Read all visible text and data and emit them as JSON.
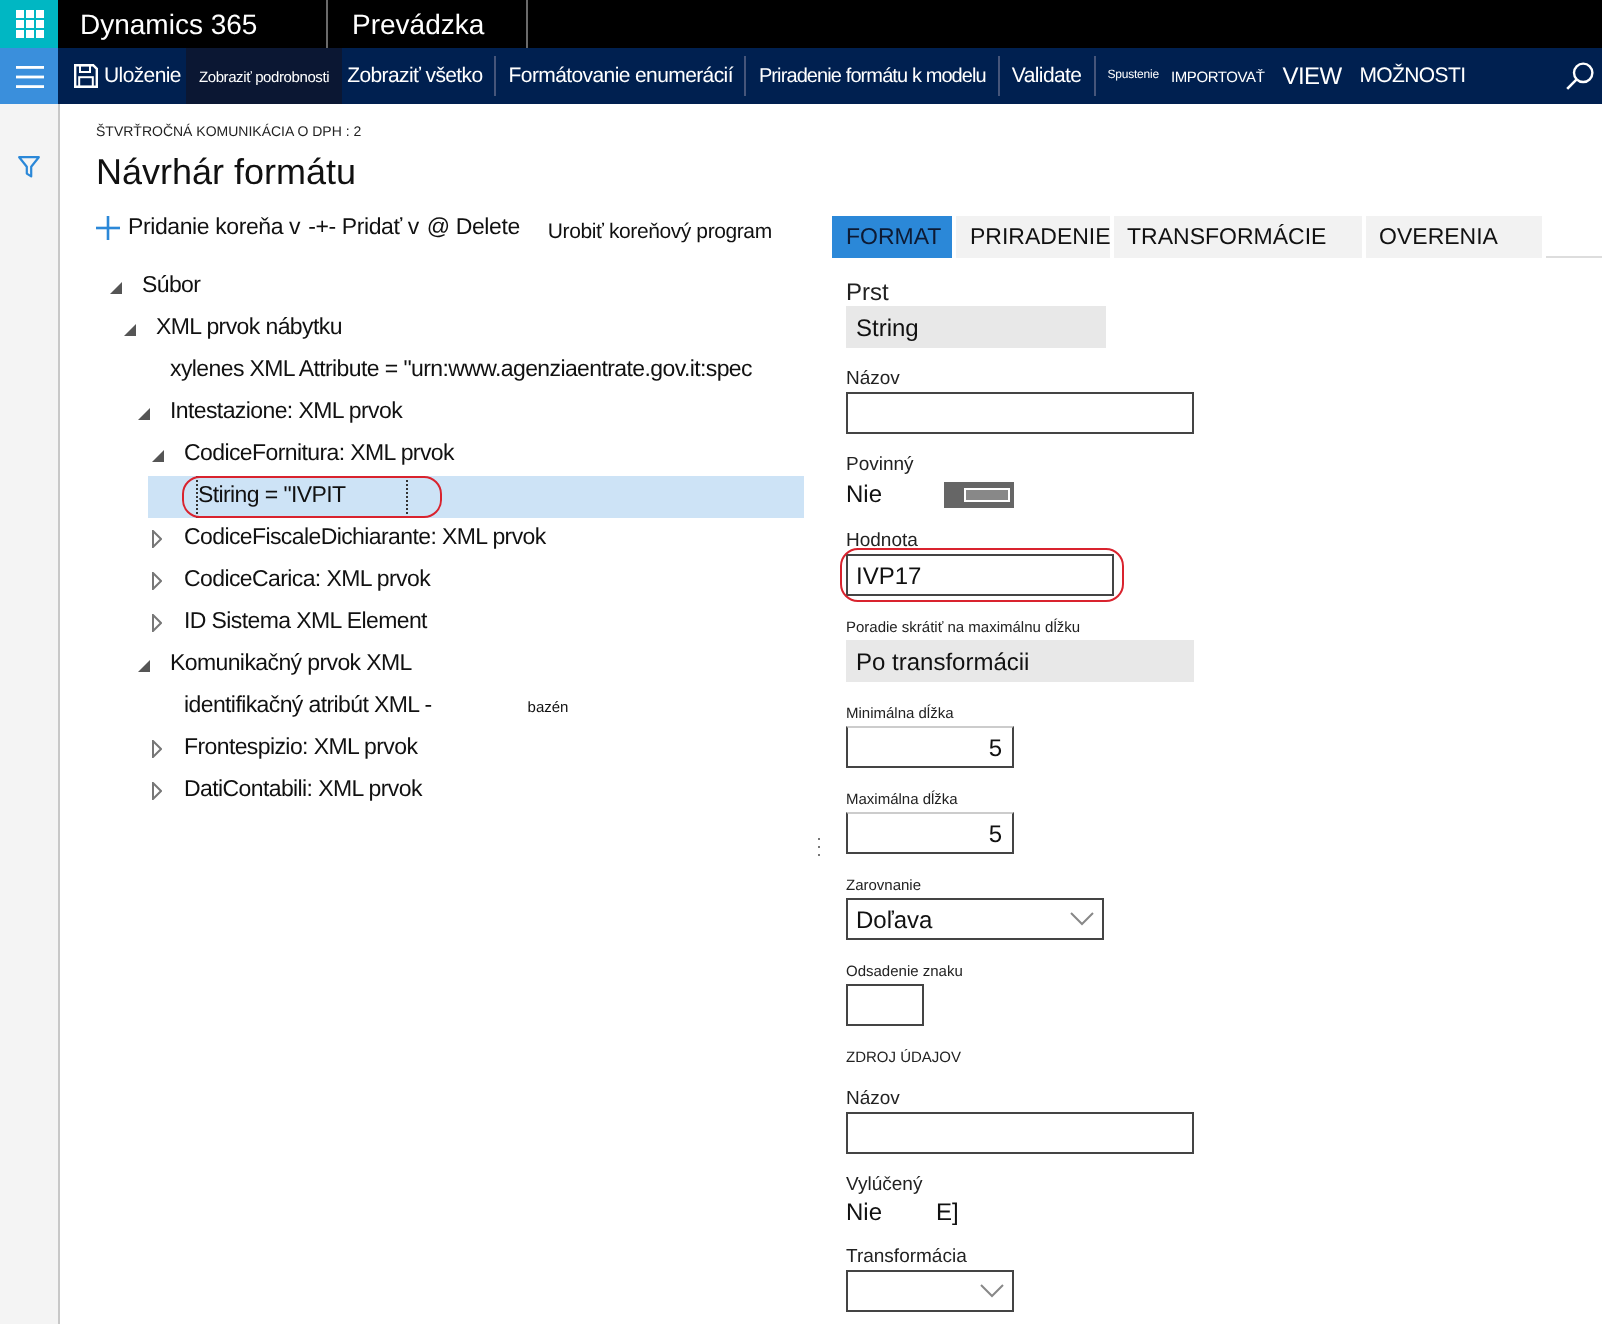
{
  "top_bar": {
    "app_name": "Dynamics 365",
    "module": "Prevádzka"
  },
  "action_bar": {
    "groups": [
      [
        {
          "label": "Uloženie",
          "kind": "save",
          "active": false
        },
        {
          "label": "Zobraziť podrobnosti",
          "kind": "compact",
          "active": true
        },
        {
          "label": "Zobraziť všetko",
          "kind": "normal",
          "active": false
        }
      ],
      [
        {
          "label": "Formátovanie enumerácií",
          "kind": "normal",
          "active": false
        }
      ],
      [
        {
          "label": "Priradenie formátu k modelu",
          "kind": "narrow",
          "active": false
        }
      ],
      [
        {
          "label": "Validate",
          "kind": "normal",
          "active": false
        }
      ],
      [
        {
          "label": "Spustenie",
          "kind": "tiny",
          "active": false
        },
        {
          "label": "IMPORTOVAŤ",
          "kind": "compact",
          "active": false
        },
        {
          "label": "VIEW",
          "kind": "large",
          "active": false
        },
        {
          "label": "MOŽNOSTI",
          "kind": "normal",
          "active": false
        }
      ]
    ]
  },
  "breadcrumb": "ŠTVRŤROČNÁ KOMUNIKÁCIA O DPH : 2",
  "title": "Návrhár formátu",
  "tree_toolbar": [
    {
      "label": "Pridanie koreňa v",
      "kind": "add"
    },
    {
      "label": "-+- Pridať v",
      "kind": "text"
    },
    {
      "label": "@ Delete",
      "kind": "text"
    },
    {
      "label": "Urobiť koreňový program",
      "kind": "small"
    }
  ],
  "tree": [
    {
      "label": "Súbor",
      "kind": "branch",
      "expanded": true,
      "selected": false,
      "children": [
        {
          "label": "XML prvok nábytku",
          "kind": "branch",
          "expanded": true,
          "selected": false,
          "children": [
            {
              "label": "xylenes XML Attribute = \"urn:www.agenziaentrate.gov.it:spec",
              "kind": "leaf",
              "selected": false
            },
            {
              "label": "Intestazione: XML prvok",
              "kind": "branch",
              "expanded": true,
              "selected": false,
              "children": [
                {
                  "label": "CodiceFornitura: XML prvok",
                  "kind": "branch",
                  "expanded": true,
                  "selected": false,
                  "children": [
                    {
                      "label": "Stiring = \"IVPIT",
                      "kind": "leaf",
                      "selected": true,
                      "circled": true
                    }
                  ]
                },
                {
                  "label": "CodiceFiscaleDichiarante: XML prvok",
                  "kind": "branch",
                  "expanded": false,
                  "selected": false
                },
                {
                  "label": "CodiceCarica: XML prvok",
                  "kind": "branch",
                  "expanded": false,
                  "selected": false
                },
                {
                  "label": "ID Sistema XML Element",
                  "kind": "branch",
                  "expanded": false,
                  "selected": false
                }
              ]
            },
            {
              "label": "Komunikačný prvok XML",
              "kind": "branch",
              "expanded": true,
              "selected": false,
              "children": [
                {
                  "label": "identifikačný atribút XML -",
                  "note": "bazén",
                  "kind": "leaf",
                  "selected": false
                },
                {
                  "label": "Frontespizio: XML prvok",
                  "kind": "branch",
                  "expanded": false,
                  "selected": false
                },
                {
                  "label": "DatiContabili: XML prvok",
                  "kind": "branch",
                  "expanded": false,
                  "selected": false
                }
              ]
            }
          ]
        }
      ]
    }
  ],
  "tabs": [
    {
      "label": "FORMAT",
      "selected": true
    },
    {
      "label": "PRIRADENIE",
      "selected": false
    },
    {
      "label": "TRANSFORMÁCIE",
      "selected": false
    },
    {
      "label": "OVERENIA",
      "selected": false
    }
  ],
  "fields": [
    {
      "kind": "readonly",
      "label": "Prst",
      "value": "String"
    },
    {
      "kind": "text",
      "label": "Názov"
    },
    {
      "kind": "toggle",
      "label": "Povinný",
      "value": "Nie",
      "on": false
    },
    {
      "kind": "text",
      "label": "Hodnota",
      "value": "IVP17",
      "circled": true
    },
    {
      "kind": "readonly",
      "label": "Poradie skrátiť na maximálnu dĺžku",
      "value": "Po transformácii"
    },
    {
      "kind": "number",
      "label": "Minimálna dĺžka",
      "value": "5"
    },
    {
      "kind": "number",
      "label": "Maximálna dĺžka",
      "value": "5"
    },
    {
      "kind": "select",
      "label": "Zarovnanie",
      "value": "Doľava"
    },
    {
      "kind": "text",
      "label": "Odsadenie znaku"
    },
    {
      "kind": "section",
      "label": "ZDROJ ÚDAJOV"
    },
    {
      "kind": "text",
      "label": "Názov"
    },
    {
      "kind": "flag",
      "label": "Vylúčený",
      "value": "Nie",
      "mark": "E]"
    },
    {
      "kind": "select",
      "label": "Transformácia"
    }
  ]
}
